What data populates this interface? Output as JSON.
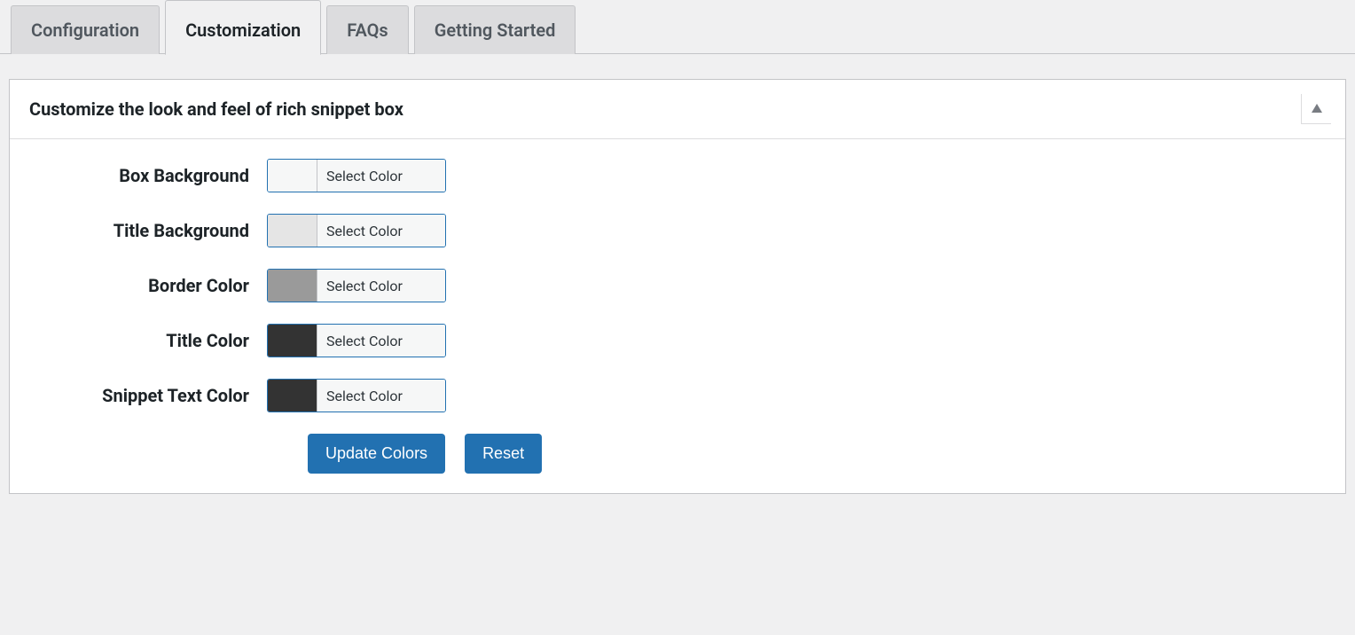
{
  "tabs": {
    "configuration": "Configuration",
    "customization": "Customization",
    "faqs": "FAQs",
    "getting_started": "Getting Started"
  },
  "panel": {
    "title": "Customize the look and feel of rich snippet box"
  },
  "fields": {
    "box_background": {
      "label": "Box Background",
      "picker_label": "Select Color",
      "swatch": "#f6f7f7"
    },
    "title_background": {
      "label": "Title Background",
      "picker_label": "Select Color",
      "swatch": "#e5e5e5"
    },
    "border_color": {
      "label": "Border Color",
      "picker_label": "Select Color",
      "swatch": "#9a9a9a"
    },
    "title_color": {
      "label": "Title Color",
      "picker_label": "Select Color",
      "swatch": "#333333"
    },
    "snippet_text_color": {
      "label": "Snippet Text Color",
      "picker_label": "Select Color",
      "swatch": "#333333"
    }
  },
  "buttons": {
    "update": "Update Colors",
    "reset": "Reset"
  }
}
